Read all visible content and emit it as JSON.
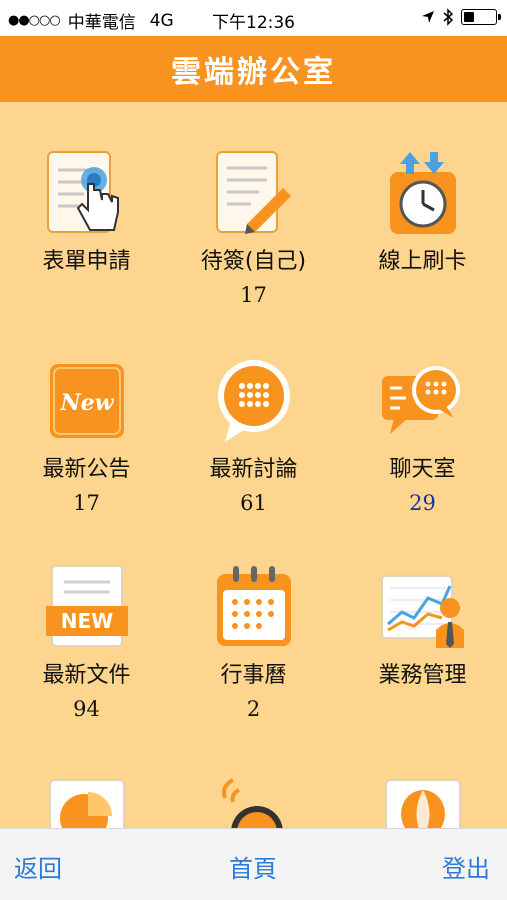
{
  "status": {
    "signal": "●●○○○",
    "carrier": "中華電信",
    "network": "4G",
    "time": "下午12:36",
    "battery_level": 0.35
  },
  "header": {
    "title": "雲端辦公室"
  },
  "tiles": [
    {
      "label": "表單申請",
      "count": "",
      "icon": "form-touch-icon"
    },
    {
      "label": "待簽(自己)",
      "count": "17",
      "icon": "document-pencil-icon"
    },
    {
      "label": "線上刷卡",
      "count": "",
      "icon": "clock-arrows-icon"
    },
    {
      "label": "最新公告",
      "count": "17",
      "icon": "new-badge-icon"
    },
    {
      "label": "最新討論",
      "count": "61",
      "icon": "chat-bubble-icon"
    },
    {
      "label": "聊天室",
      "count": "29",
      "icon": "chatroom-icon"
    },
    {
      "label": "最新文件",
      "count": "94",
      "icon": "new-document-icon"
    },
    {
      "label": "行事曆",
      "count": "2",
      "icon": "calendar-icon"
    },
    {
      "label": "業務管理",
      "count": "",
      "icon": "business-chart-icon"
    },
    {
      "label": "",
      "count": "",
      "icon": "pie-chart-icon"
    },
    {
      "label": "",
      "count": "",
      "icon": "bell-icon"
    },
    {
      "label": "",
      "count": "",
      "icon": "balloon-icon"
    }
  ],
  "tabbar": {
    "back": "返回",
    "home": "首頁",
    "logout": "登出"
  },
  "colors": {
    "header": "#f7931e",
    "background": "#fdd58f",
    "link": "#2d7bd6",
    "chat_count": "#2030a0"
  }
}
